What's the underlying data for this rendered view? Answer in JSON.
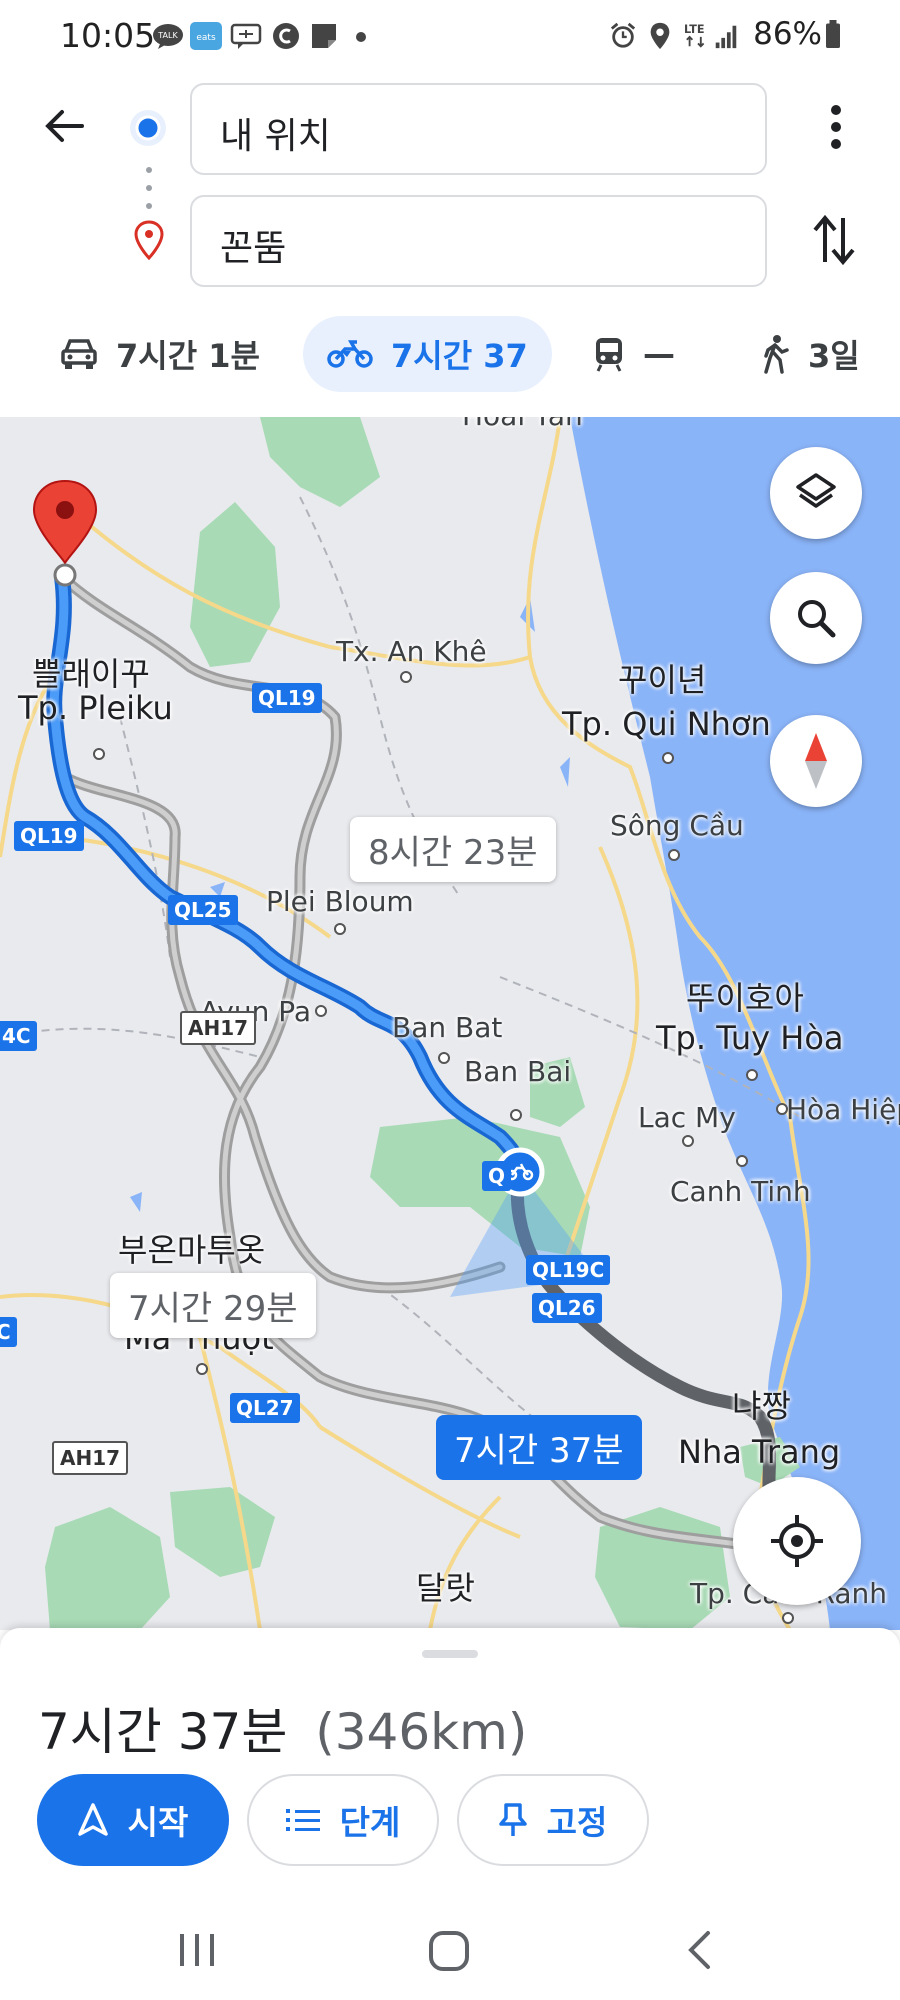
{
  "status_bar": {
    "time": "10:05",
    "battery": "86%",
    "network": "LTE",
    "notification_icons": [
      "talk-icon",
      "eats-icon",
      "message-icon",
      "c-icon",
      "note-icon",
      "dot-icon"
    ],
    "talk_badge": "TALK",
    "eats_badge": "eats"
  },
  "search": {
    "origin": "내 위치",
    "destination": "꼰뚬"
  },
  "modes": [
    {
      "id": "car",
      "label": "7시간 1분",
      "selected": false
    },
    {
      "id": "motorbike",
      "label": "7시간 37",
      "selected": true
    },
    {
      "id": "transit",
      "label": "—",
      "selected": false
    },
    {
      "id": "walk",
      "label": "3일",
      "selected": false
    }
  ],
  "map": {
    "route_labels": {
      "alt1": "8시간 23분",
      "alt2": "7시간 29분",
      "main": "7시간 37분"
    },
    "places": [
      {
        "id": "hoai-tan",
        "text": "Hoài Tân"
      },
      {
        "id": "pleiku-ko",
        "text": "쁠래이꾸"
      },
      {
        "id": "pleiku",
        "text": "Tp. Pleiku"
      },
      {
        "id": "an-khe",
        "text": "Tx. An Khê"
      },
      {
        "id": "quinhon-ko",
        "text": "꾸이년"
      },
      {
        "id": "quinhon",
        "text": "Tp. Qui Nhơn"
      },
      {
        "id": "song-cau",
        "text": "Sông Cầu"
      },
      {
        "id": "plei-bloum",
        "text": "Plei Bloum"
      },
      {
        "id": "ayun-pa",
        "text": "Ayun Pa"
      },
      {
        "id": "ban-bat",
        "text": "Ban Bat"
      },
      {
        "id": "ban-bai",
        "text": "Ban Bai"
      },
      {
        "id": "tuyhoa-ko",
        "text": "뚜이호아"
      },
      {
        "id": "tuyhoa",
        "text": "Tp. Tuy Hòa"
      },
      {
        "id": "lac-my",
        "text": "Lac My"
      },
      {
        "id": "hoa-hiep",
        "text": "Hòa Hiệp"
      },
      {
        "id": "canh-tinh",
        "text": "Canh Tinh"
      },
      {
        "id": "bmt-ko",
        "text": "부온마투옷"
      },
      {
        "id": "bmt",
        "text": "Ma Thuột"
      },
      {
        "id": "nhatrang-ko",
        "text": "냐짱"
      },
      {
        "id": "nhatrang",
        "text": "Nha Trang"
      },
      {
        "id": "dalat-ko",
        "text": "달랏"
      },
      {
        "id": "camranh",
        "text": "Tp. Cam Ranh"
      }
    ],
    "shields": [
      "QL19",
      "QL19",
      "QL25",
      "AH17",
      "QL19C",
      "QL26",
      "QL27",
      "AH17",
      "4C",
      "Q",
      "C"
    ]
  },
  "sheet": {
    "duration": "7시간 37분",
    "distance": "(346km)",
    "start_label": "시작",
    "steps_label": "단계",
    "pin_label": "고정"
  },
  "colors": {
    "primary": "#1a73e8",
    "route_blue": "#2f8ef4",
    "route_alt": "#9e9e9e",
    "water": "#8ab4f8",
    "park": "#a8dab5",
    "pin_red": "#ea4335"
  }
}
